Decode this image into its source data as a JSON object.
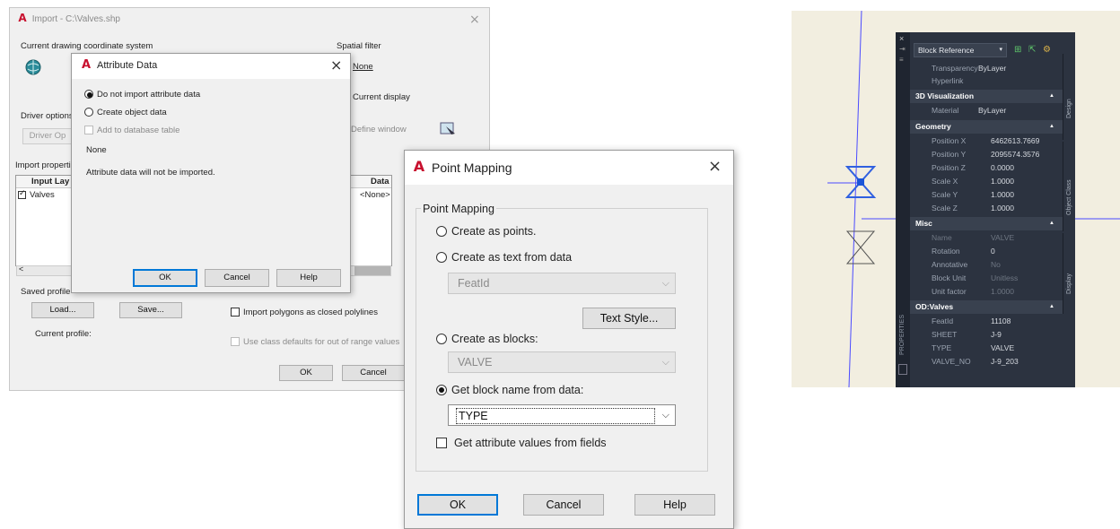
{
  "import_dialog": {
    "title": "Import - C:\\Valves.shp",
    "coord_label": "Current drawing coordinate system",
    "spatial_filter_label": "Spatial filter",
    "spatial_none": "None",
    "current_display": "Current display",
    "define_window": "Define window",
    "driver_options_label": "Driver options",
    "driver_button": "Driver Op",
    "import_properties_label": "Import properti",
    "col_input_layer": "Input Lay",
    "col_data": "Data",
    "row_layer": "Valves",
    "row_data": "<None>",
    "saved_profile_label": "Saved profile",
    "load_button": "Load...",
    "save_button": "Save...",
    "import_polygons": "Import polygons as closed polylines",
    "current_profile_label": "Current profile:",
    "use_class_defaults": "Use class defaults for out of range values",
    "ok_button": "OK",
    "cancel_button": "Cancel",
    "close": "×"
  },
  "attribute_dialog": {
    "title": "Attribute Data",
    "opt_no_import": "Do not import attribute data",
    "opt_create_object": "Create object data",
    "opt_add_db": "Add to database table",
    "none_text": "None",
    "info_text": "Attribute data will not be imported.",
    "ok_button": "OK",
    "cancel_button": "Cancel",
    "help_button": "Help",
    "close": "×"
  },
  "point_mapping": {
    "title": "Point Mapping",
    "group_label": "Point Mapping",
    "opt_points": "Create as points.",
    "opt_text": "Create as text from data",
    "text_combo": "FeatId",
    "text_style_button": "Text Style...",
    "opt_blocks": "Create as blocks:",
    "block_combo": "VALVE",
    "opt_block_from_data": "Get block name from data:",
    "data_combo": "TYPE",
    "get_attr_values": "Get attribute values from fields",
    "ok_button": "OK",
    "cancel_button": "Cancel",
    "help_button": "Help",
    "close": "×"
  },
  "properties": {
    "selector": "Block Reference",
    "rows_top": [
      {
        "k": "Transparency",
        "v": "ByLayer"
      },
      {
        "k": "Hyperlink",
        "v": ""
      }
    ],
    "sec_3d": "3D Visualization",
    "material": {
      "k": "Material",
      "v": "ByLayer"
    },
    "sec_geometry": "Geometry",
    "geometry": [
      {
        "k": "Position X",
        "v": "6462613.7669"
      },
      {
        "k": "Position Y",
        "v": "2095574.3576"
      },
      {
        "k": "Position Z",
        "v": "0.0000"
      },
      {
        "k": "Scale X",
        "v": "1.0000"
      },
      {
        "k": "Scale Y",
        "v": "1.0000"
      },
      {
        "k": "Scale Z",
        "v": "1.0000"
      }
    ],
    "sec_misc": "Misc",
    "misc": [
      {
        "k": "Name",
        "v": "VALVE"
      },
      {
        "k": "Rotation",
        "v": "0"
      },
      {
        "k": "Annotative",
        "v": "No"
      },
      {
        "k": "Block Unit",
        "v": "Unitless"
      },
      {
        "k": "Unit factor",
        "v": "1.0000"
      }
    ],
    "sec_od": "OD:Valves",
    "od": [
      {
        "k": "FeatId",
        "v": "11108"
      },
      {
        "k": "SHEET",
        "v": "J-9"
      },
      {
        "k": "TYPE",
        "v": "VALVE"
      },
      {
        "k": "VALVE_NO",
        "v": "J-9_203"
      }
    ],
    "tab_design": "Design",
    "tab_object_class": "Object Class",
    "tab_display": "Display",
    "palette_label": "PROPERTIES"
  },
  "colors": {
    "accent": "#0078d7",
    "autocad_red": "#c8102e",
    "palette_bg": "#2c3340",
    "cad_bg": "#f2eee0",
    "cad_line": "#3a3aff"
  }
}
